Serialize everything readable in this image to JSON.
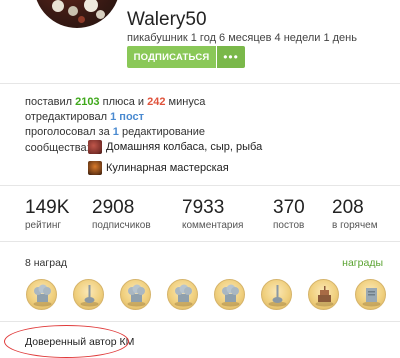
{
  "profile": {
    "username": "Walery50",
    "member_since": "пикабушник 1 год 6 месяцев 4 недели 1 день",
    "subscribe_label": "ПОДПИСАТЬСЯ",
    "more_label": "•••"
  },
  "info": {
    "votes_prefix": "поставил ",
    "plus_count": "2103",
    "votes_mid": " плюса и ",
    "minus_count": "242",
    "votes_suffix": " минуса",
    "edited_prefix": "отредактировал ",
    "edited_count": "1 пост",
    "voted_prefix": "проголосовал за ",
    "voted_count": "1",
    "voted_suffix": " редактирование",
    "communities_label": "сообщества:",
    "communities": [
      {
        "name": "Домашняя колбаса, сыр, рыба",
        "icon": "sausage-community-icon",
        "color": "#7a2f2a"
      },
      {
        "name": "Кулинарная мастерская",
        "icon": "kitchen-community-icon",
        "color": "#6d3a16"
      }
    ]
  },
  "stats": [
    {
      "value": "149K",
      "label": "рейтинг"
    },
    {
      "value": "2908",
      "label": "подписчиков"
    },
    {
      "value": "7933",
      "label": "комментария"
    },
    {
      "value": "370",
      "label": "постов"
    },
    {
      "value": "208",
      "label": "в горячем"
    }
  ],
  "awards": {
    "count_label": "8 наград",
    "link_label": "награды",
    "items": [
      {
        "icon": "chef-hat-award-icon"
      },
      {
        "icon": "ladle-award-icon"
      },
      {
        "icon": "chef-hat-award-icon"
      },
      {
        "icon": "chef-hat-award-icon"
      },
      {
        "icon": "chef-hat-award-icon"
      },
      {
        "icon": "ladle-award-icon"
      },
      {
        "icon": "cake-award-icon"
      },
      {
        "icon": "cookbook-award-icon"
      }
    ]
  },
  "trusted_author": "Доверенный автор КМ",
  "colors": {
    "accent_green": "#8ac858",
    "plus_green": "#3fa81b",
    "minus_red": "#e0533c",
    "edit_blue": "#4a8ad0",
    "annotation_red": "#e03b3b"
  }
}
